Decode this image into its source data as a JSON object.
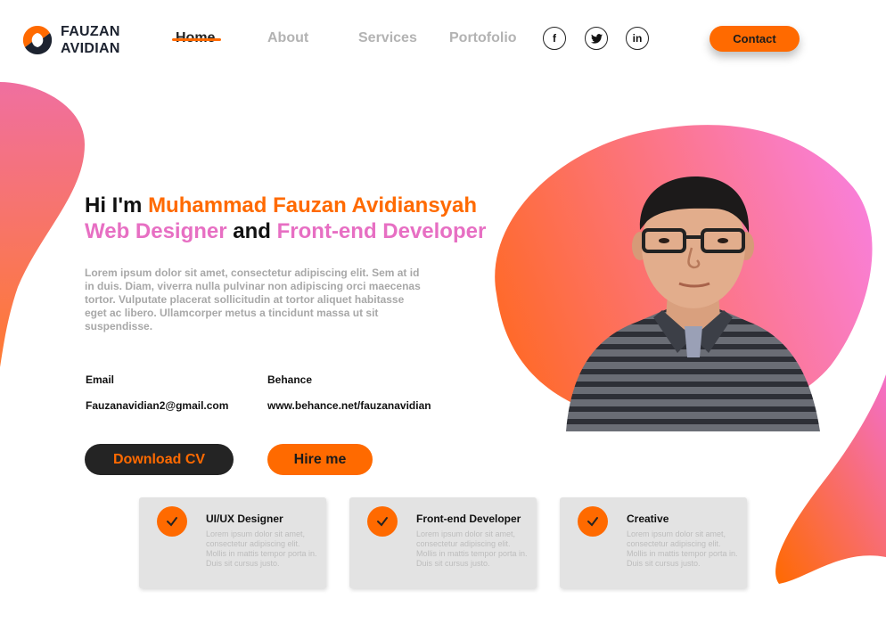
{
  "brand": {
    "line1": "FAUZAN",
    "line2": "AVIDIAN",
    "accent_color": "#ff6a00",
    "pink_color": "#e76fc3"
  },
  "nav": {
    "items": [
      {
        "label": "Home",
        "active": true
      },
      {
        "label": "About"
      },
      {
        "label": "Services"
      },
      {
        "label": "Portofolio"
      }
    ]
  },
  "social": {
    "facebook": {
      "glyph": "f",
      "icon": "facebook-icon"
    },
    "twitter": {
      "glyph": "t",
      "icon": "twitter-icon"
    },
    "linkedin": {
      "glyph": "in",
      "icon": "linkedin-icon"
    }
  },
  "contact_label": "Contact",
  "hero": {
    "greeting": "Hi I'm",
    "name": "Muhammad Fauzan Avidiansyah",
    "role1": "Web Designer",
    "and": "and",
    "role2": "Front-end Developer",
    "description": "Lorem ipsum dolor sit amet, consectetur adipiscing elit. Sem at id in duis. Diam, viverra nulla pulvinar non adipiscing orci maecenas tortor. Vulputate placerat sollicitudin at tortor aliquet habitasse eget ac libero. Ullamcorper metus a tincidunt massa ut sit suspendisse."
  },
  "contact_info": {
    "email_label": "Email",
    "email_value": "Fauzanavidian2@gmail.com",
    "behance_label": "Behance",
    "behance_value": "www.behance.net/fauzanavidian"
  },
  "buttons": {
    "download_cv": "Download CV",
    "hire_me": "Hire me"
  },
  "services": [
    {
      "title": "UI/UX Designer",
      "body": "Lorem ipsum dolor sit amet, consectetur adipiscing elit. Mollis in mattis tempor porta in. Duis sit cursus justo."
    },
    {
      "title": "Front-end Developer",
      "body": "Lorem ipsum dolor sit amet, consectetur adipiscing elit. Mollis in mattis tempor porta in. Duis sit cursus justo."
    },
    {
      "title": "Creative",
      "body": "Lorem ipsum dolor sit amet, consectetur adipiscing elit. Mollis in mattis tempor porta in. Duis sit cursus justo."
    }
  ]
}
